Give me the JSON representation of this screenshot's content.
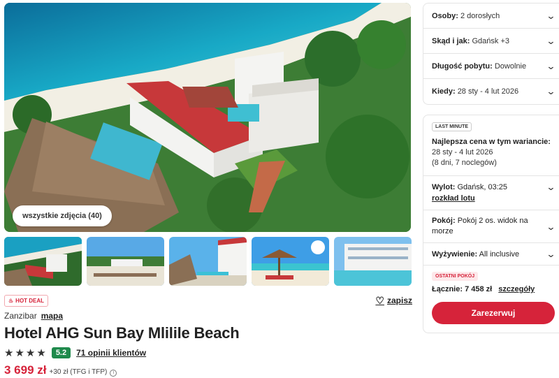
{
  "gallery": {
    "all_photos_label": "wszystkie zdjęcia (40)",
    "thumbnail_count": 5
  },
  "deal": {
    "hot_deal_label": "HOT DEAL",
    "save_label": "zapisz"
  },
  "hotel": {
    "location": "Zanzibar",
    "map_label": "mapa",
    "name": "Hotel AHG Sun Bay Mlilile Beach",
    "stars": 4,
    "score": "5.2",
    "reviews_label": "71 opinii klientów"
  },
  "price": {
    "main": "3 699 zł",
    "extra": "+30 zł (TFG i TFP)",
    "info_icon": "i"
  },
  "search": {
    "guests_label": "Osoby:",
    "guests_value": "2 dorosłych",
    "from_label": "Skąd i jak:",
    "from_value": "Gdańsk +3",
    "duration_label": "Długość pobytu:",
    "duration_value": "Dowolnie",
    "when_label": "Kiedy:",
    "when_value": "28 sty - 4 lut 2026"
  },
  "offer": {
    "last_minute_label": "LAST MINUTE",
    "best_price_label": "Najlepsza cena w tym wariancie:",
    "dates": "28 sty - 4 lut 2026",
    "nights": "(8 dni, 7 noclegów)",
    "flight_label": "Wylot:",
    "flight_value": "Gdańsk, 03:25",
    "flight_schedule_label": "rozkład lotu",
    "room_label": "Pokój:",
    "room_value": "Pokój 2 os. widok na morze",
    "board_label": "Wyżywienie:",
    "board_value": "All inclusive",
    "last_rooms_label": "OSTATNI POKÓJ",
    "total_label": "Łącznie: 7 458 zł",
    "details_label": "szczegóły",
    "book_label": "Zarezerwuj"
  },
  "colors": {
    "brand_red": "#d6233a",
    "score_green": "#1f8a4c"
  }
}
